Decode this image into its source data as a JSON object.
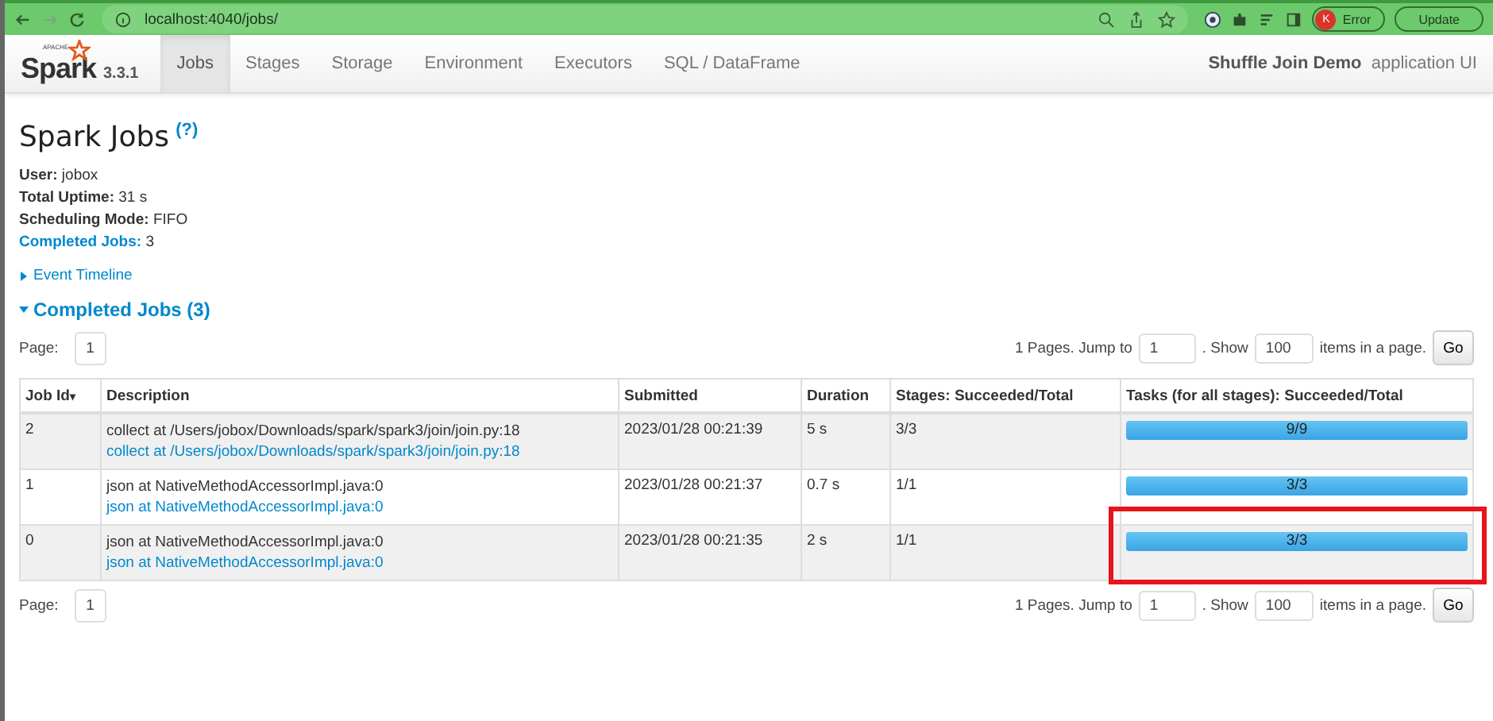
{
  "browser": {
    "url": "localhost:4040/jobs/",
    "profile_initial": "K",
    "profile_status": "Error",
    "update_button": "Update"
  },
  "nav": {
    "logo_word": "Spark",
    "logo_tag": "APACHE",
    "version": "3.3.1",
    "tabs": [
      {
        "label": "Jobs",
        "selected": true
      },
      {
        "label": "Stages",
        "selected": false
      },
      {
        "label": "Storage",
        "selected": false
      },
      {
        "label": "Environment",
        "selected": false
      },
      {
        "label": "Executors",
        "selected": false
      },
      {
        "label": "SQL / DataFrame",
        "selected": false
      }
    ],
    "app_name": "Shuffle Join Demo",
    "app_suffix": "application UI"
  },
  "title": "Spark Jobs",
  "help": "(?)",
  "summary": [
    {
      "label": "User:",
      "value": "jobox",
      "link": false
    },
    {
      "label": "Total Uptime:",
      "value": "31 s",
      "link": false
    },
    {
      "label": "Scheduling Mode:",
      "value": "FIFO",
      "link": false
    },
    {
      "label": "Completed Jobs:",
      "value": "3",
      "link": true
    }
  ],
  "event_timeline": {
    "label": "Event Timeline",
    "expanded": false
  },
  "section": {
    "label": "Completed Jobs (3)",
    "expanded": true
  },
  "pagers": [
    {
      "page_label": "Page:",
      "page": "1",
      "pages_text": "1 Pages. Jump to",
      "jump": "1",
      "show_text": ". Show",
      "show": "100",
      "items_text": "items in a page.",
      "go": "Go"
    },
    {
      "page_label": "Page:",
      "page": "1",
      "pages_text": "1 Pages. Jump to",
      "jump": "1",
      "show_text": ". Show",
      "show": "100",
      "items_text": "items in a page.",
      "go": "Go"
    }
  ],
  "table": {
    "columns": [
      "Job Id",
      "Description",
      "Submitted",
      "Duration",
      "Stages: Succeeded/Total",
      "Tasks (for all stages): Succeeded/Total"
    ],
    "sort_mark": "▾",
    "rows": [
      {
        "id": "2",
        "desc": "collect at /Users/jobox/Downloads/spark/spark3/join/join.py:18",
        "desc_link": "collect at /Users/jobox/Downloads/spark/spark3/join/join.py:18",
        "submitted": "2023/01/28 00:21:39",
        "duration": "5 s",
        "stages": "3/3",
        "tasks": "9/9",
        "level": 1,
        "highlighted": false
      },
      {
        "id": "1",
        "desc": "json at NativeMethodAccessorImpl.java:0",
        "desc_link": "json at NativeMethodAccessorImpl.java:0",
        "submitted": "2023/01/28 00:21:37",
        "duration": "0.7 s",
        "stages": "1/1",
        "tasks": "3/3",
        "level": 1,
        "highlighted": false
      },
      {
        "id": "0",
        "desc": "json at NativeMethodAccessorImpl.java:0",
        "desc_link": "json at NativeMethodAccessorImpl.java:0",
        "submitted": "2023/01/28 00:21:35",
        "duration": "2 s",
        "stages": "1/1",
        "tasks": "3/3",
        "level": 1,
        "highlighted": true
      }
    ]
  }
}
